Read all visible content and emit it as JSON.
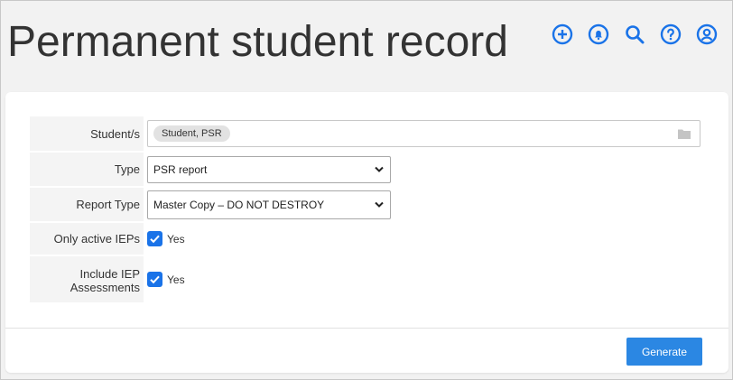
{
  "header": {
    "title": "Permanent student record",
    "icons": [
      "add-circle-icon",
      "bell-icon",
      "search-icon",
      "help-icon",
      "account-icon"
    ],
    "icon_color": "#1a73e8"
  },
  "form": {
    "students": {
      "label": "Student/s",
      "chips": [
        "Student, PSR"
      ]
    },
    "type": {
      "label": "Type",
      "value": "PSR report"
    },
    "report_type": {
      "label": "Report Type",
      "value": "Master Copy – DO NOT DESTROY"
    },
    "only_active_ieps": {
      "label": "Only active IEPs",
      "checked": true,
      "option_label": "Yes"
    },
    "include_iep_assessments": {
      "label": "Include IEP Assessments",
      "checked": true,
      "option_label": "Yes"
    }
  },
  "footer": {
    "generate_label": "Generate",
    "button_color": "#2b87e3"
  }
}
